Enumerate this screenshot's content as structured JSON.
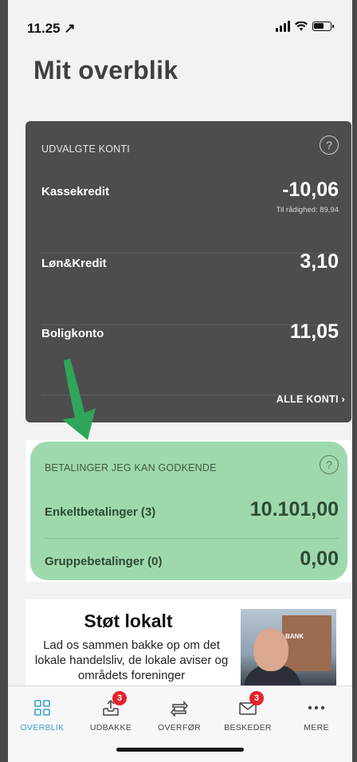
{
  "status_bar": {
    "time": "11.25 ↗"
  },
  "page": {
    "title": "Mit overblik"
  },
  "accounts": {
    "header": "UDVALGTE KONTI",
    "help": "?",
    "items": [
      {
        "name": "Kassekredit",
        "value": "-10,06",
        "sub": "Til rådighed: 89,94"
      },
      {
        "name": "Løn&Kredit",
        "value": "3,10",
        "sub": ""
      },
      {
        "name": "Boligkonto",
        "value": "11,05",
        "sub": ""
      }
    ],
    "all_link": "ALLE KONTI ›"
  },
  "payments": {
    "header": "BETALINGER JEG KAN GODKENDE",
    "help": "?",
    "items": [
      {
        "name": "Enkeltbetalinger (3)",
        "value": "10.101,00"
      },
      {
        "name": "Gruppebetalinger (0)",
        "value": "0,00"
      }
    ]
  },
  "promo": {
    "title": "Støt lokalt",
    "text": "Lad os sammen bakke op om det lokale handelsliv, de lokale aviser og områdets foreninger",
    "image_sign": "BANK"
  },
  "tabs": [
    {
      "label": "OVERBLIK",
      "icon": "grid-icon",
      "badge": "",
      "active": true
    },
    {
      "label": "UDBAKKE",
      "icon": "outbox-icon",
      "badge": "3",
      "active": false
    },
    {
      "label": "OVERFØR",
      "icon": "transfer-icon",
      "badge": "",
      "active": false
    },
    {
      "label": "BESKEDER",
      "icon": "mail-icon",
      "badge": "3",
      "active": false
    },
    {
      "label": "MERE",
      "icon": "more-icon",
      "badge": "",
      "active": false
    }
  ],
  "colors": {
    "accent": "#3aa0c8",
    "dark_card": "#4d4d4d",
    "highlight": "#9ed9ad",
    "arrow": "#2fa55a",
    "badge": "#e5222a"
  }
}
